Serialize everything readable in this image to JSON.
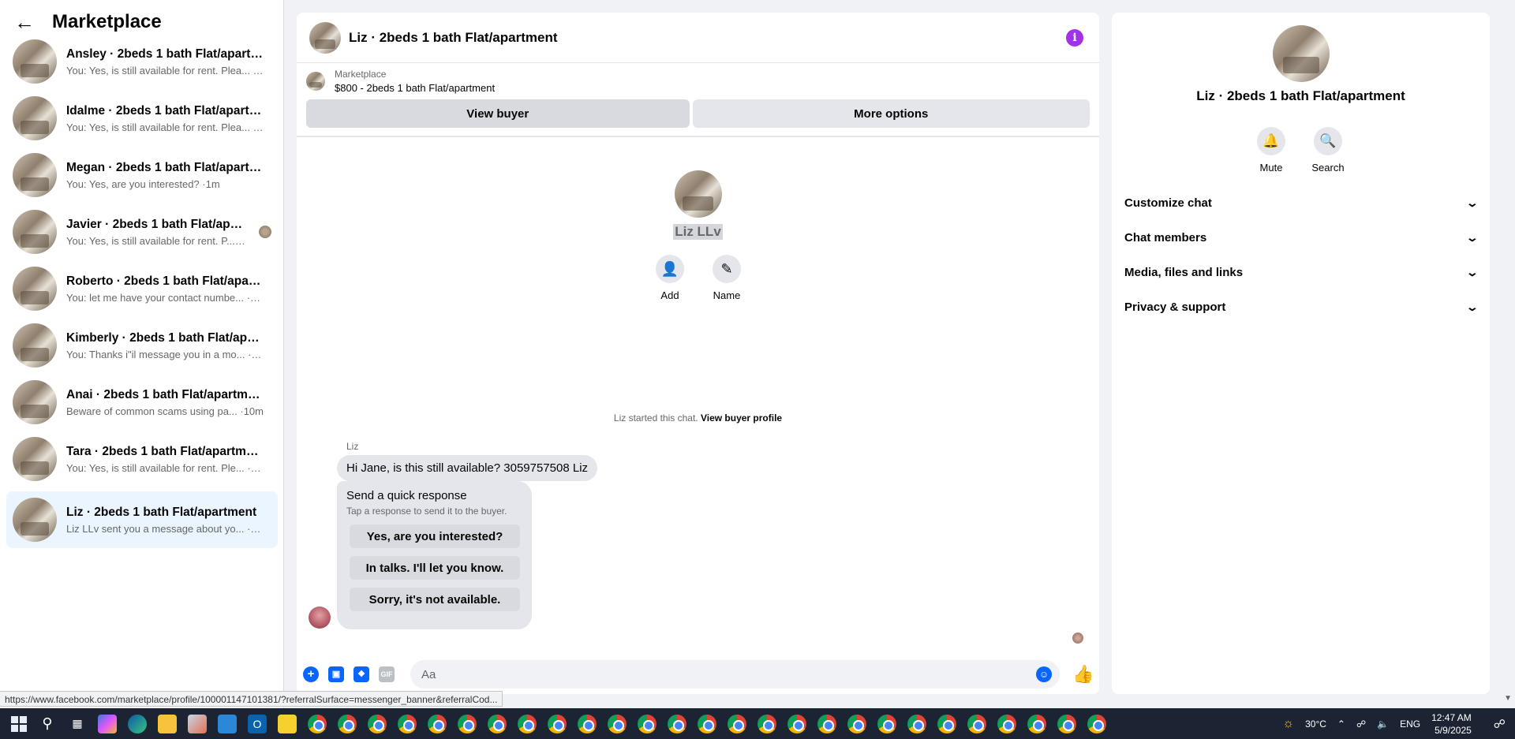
{
  "sidebar": {
    "title": "Marketplace",
    "conversations": [
      {
        "name": "Ansley · 2beds 1 bath Flat/apartme...",
        "preview": "You: Yes, is still available for rent. Plea... ·1m"
      },
      {
        "name": "Idalme · 2beds 1 bath Flat/apartm...",
        "preview": "You: Yes, is still available for rent. Plea... ·1m"
      },
      {
        "name": "Megan · 2beds 1 bath Flat/apartm...",
        "preview": "You: Yes, are you interested? ·1m"
      },
      {
        "name": "Javier · 2beds 1 bath Flat/apart...",
        "preview": "You: Yes, is still available for rent. P... ·1m"
      },
      {
        "name": "Roberto · 2beds 1 bath Flat/apart...",
        "preview": "You: let me have your contact numbe... ·1m"
      },
      {
        "name": "Kimberly · 2beds 1 bath Flat/apart...",
        "preview": "You: Thanks i\"il message you in a mo... ·1m"
      },
      {
        "name": "Anai · 2beds 1 bath Flat/apartment",
        "preview": "Beware of common scams using pa... ·10m"
      },
      {
        "name": "Tara · 2beds 1 bath Flat/apartment",
        "preview": "You: Yes, is still available for rent. Ple... ·10m"
      },
      {
        "name": "Liz · 2beds 1 bath Flat/apartment",
        "preview": "Liz LLv sent you a message about yo... ·13h"
      }
    ]
  },
  "chat": {
    "title": "Liz · 2beds 1 bath Flat/apartment",
    "marketplace_label": "Marketplace",
    "listing": "$800 - 2beds 1 bath Flat/apartment",
    "view_buyer": "View buyer",
    "more_options": "More options",
    "profile_name": "Liz LLv",
    "add_label": "Add",
    "name_label": "Name",
    "system_text": "Liz started this chat.",
    "system_link": "View buyer profile",
    "sender": "Liz",
    "message": "Hi Jane, is this still available? 3059757508 Liz",
    "quick_title": "Send a quick response",
    "quick_sub": "Tap a response to send it to the buyer.",
    "quick_options": [
      "Yes, are you interested?",
      "In talks. I'll let you know.",
      "Sorry, it's not available."
    ],
    "composer_placeholder": "Aa"
  },
  "details": {
    "name": "Liz · 2beds 1 bath Flat/apartment",
    "mute_label": "Mute",
    "search_label": "Search",
    "sections": [
      "Customize chat",
      "Chat members",
      "Media, files and links",
      "Privacy & support"
    ]
  },
  "status_url": "https://www.facebook.com/marketplace/profile/100001147101381/?referralSurface=messenger_banner&referralCod...",
  "taskbar": {
    "temperature": "30°C",
    "language": "ENG",
    "time": "12:47 AM",
    "date": "5/9/2025"
  },
  "colors": {
    "accent": "#0866ff",
    "info": "#a033e8",
    "active_bg": "#ebf5ff"
  },
  "icons": [
    "back-arrow-icon",
    "info-icon",
    "add-person-icon",
    "pencil-icon",
    "bell-icon",
    "search-icon",
    "chevron-down-icon",
    "plus-circle-icon",
    "image-icon",
    "sticker-icon",
    "gif-icon",
    "emoji-icon",
    "like-icon"
  ]
}
